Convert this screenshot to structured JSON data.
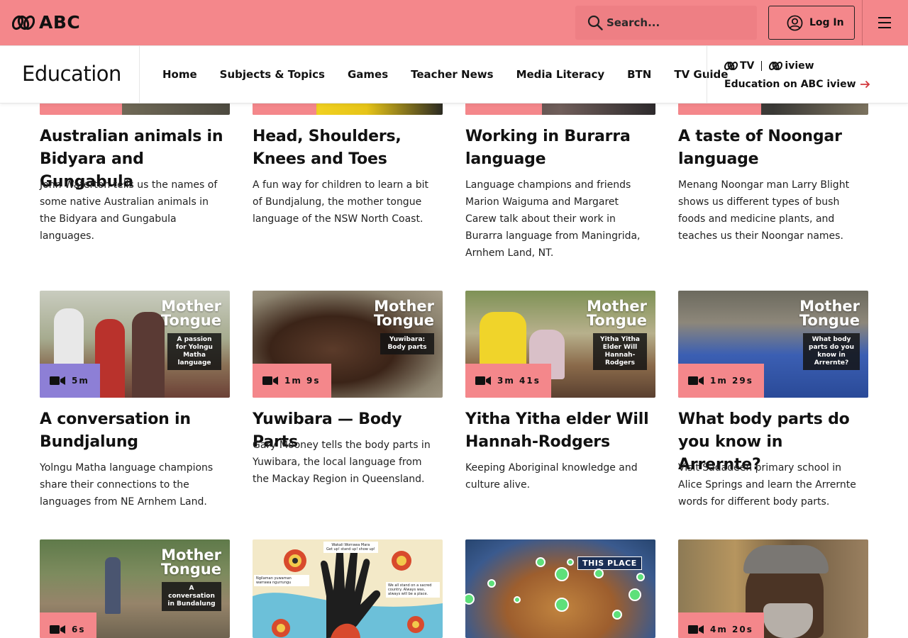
{
  "header": {
    "logo_text": "ABC",
    "search_placeholder": "Search...",
    "login_label": "Log In",
    "brand_color": "#f4878b"
  },
  "nav": {
    "section_title": "Education",
    "links": [
      "Home",
      "Subjects & Topics",
      "Games",
      "Teacher News",
      "Media Literacy",
      "BTN",
      "TV Guide"
    ],
    "iview_logo_tv": "TV",
    "iview_logo_iview": "iview",
    "iview_link": "Education on ABC iview"
  },
  "cards_row1": [
    {
      "title": "Australian animals in Bidyara and Gungabula",
      "desc": "John Waterton tells us the names of some native Australian animals in the Bidyara and Gungabula languages."
    },
    {
      "title": "Head, Shoulders, Knees and Toes",
      "desc": "A fun way for children to learn a bit of Bundjalung, the mother tongue language of the NSW North Coast."
    },
    {
      "title": "Working in Burarra language",
      "desc": "Language champions and friends Marion Waiguma and Margaret Carew talk about their work in Burarra language from Maningrida, Arnhem Land, NT."
    },
    {
      "title": "A taste of Noongar language",
      "desc": "Menang Noongar man Larry Blight shows us different types of bush foods and medicine plants, and teaches us their Noongar names."
    }
  ],
  "cards_row2": [
    {
      "duration": "5m",
      "mt_title": "Mother Tongue",
      "mt_sub": "A passion for Yolngu Matha language",
      "title": "A conversation in Bundjalung",
      "desc": "Yolngu Matha language champions share their connections to the languages from NE Arnhem Land."
    },
    {
      "duration": "1m 9s",
      "mt_title": "Mother Tongue",
      "mt_sub": "Yuwibara: Body parts",
      "title": "Yuwibara — Body Parts",
      "desc": "Gary Mooney tells the body parts in Yuwibara, the local language from the Mackay Region in Queensland."
    },
    {
      "duration": "3m 41s",
      "mt_title": "Mother Tongue",
      "mt_sub": "Yitha Yitha Elder Will Hannah-Rodgers",
      "title": "Yitha Yitha elder Will Hannah-Rodgers",
      "desc": "Keeping Aboriginal knowledge and culture alive."
    },
    {
      "duration": "1m 29s",
      "mt_title": "Mother Tongue",
      "mt_sub": "What body parts do you know in Arrernte?",
      "title": "What body parts do you know in Arrernte?",
      "desc": "Visit Sadadeen primary school in Alice Springs and learn the Arrernte words for different body parts."
    }
  ],
  "cards_row3": [
    {
      "duration": "6s",
      "mt_title": "Mother Tongue",
      "mt_sub": "A conversation in Bundalung"
    },
    {
      "duration": "",
      "art_text_1": "Wakali Worrawa Mara",
      "art_text_2": "Get up! stand up! show up!",
      "art_text_3": "Ngilaman yuwaman warrawa ngurrungu",
      "art_text_4": "We all stand on a sacred country. Always was, always will be a place."
    },
    {
      "duration": "",
      "this_place": "THIS PLACE"
    },
    {
      "duration": "4m 20s"
    }
  ]
}
